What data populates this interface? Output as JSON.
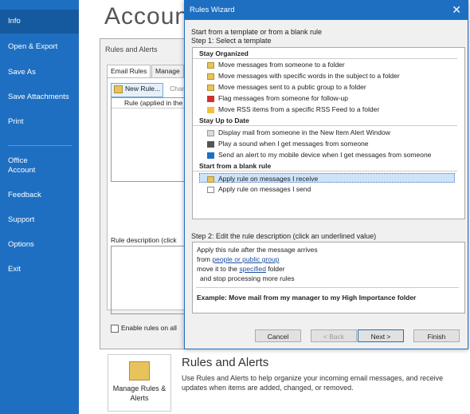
{
  "nav": {
    "items": [
      "Info",
      "Open & Export",
      "Save As",
      "Save Attachments",
      "Print",
      "Office Account",
      "Feedback",
      "Support",
      "Options",
      "Exit"
    ]
  },
  "main": {
    "title": "Accoun",
    "rules_dialog": {
      "title": "Rules and Alerts",
      "tab_email_rules": "Email Rules",
      "tab_manage": "Manage",
      "new_rule_button": "New Rule...",
      "change_button": "Chan",
      "rule_column_header": "Rule (applied in the",
      "rule_description_label": "Rule description (click",
      "enable_rules_label": "Enable rules on all"
    },
    "manage_button_label": "Manage Rules & Alerts",
    "section_heading": "Rules and Alerts",
    "section_description": "Use Rules and Alerts to help organize your incoming email messages, and receive updates when items are added, changed, or removed."
  },
  "wizard": {
    "title": "Rules Wizard",
    "start_text": "Start from a template or from a blank rule",
    "step1_label": "Step 1: Select a template",
    "groups": [
      {
        "name": "Stay Organized",
        "items": [
          {
            "label": "Move messages from someone to a folder",
            "icon": "folder-icon"
          },
          {
            "label": "Move messages with specific words in the subject to a folder",
            "icon": "folder-icon"
          },
          {
            "label": "Move messages sent to a public group to a folder",
            "icon": "folder-icon"
          },
          {
            "label": "Flag messages from someone for follow-up",
            "icon": "flag-icon"
          },
          {
            "label": "Move RSS items from a specific RSS Feed to a folder",
            "icon": "rss-icon"
          }
        ]
      },
      {
        "name": "Stay Up to Date",
        "items": [
          {
            "label": "Display mail from someone in the New Item Alert Window",
            "icon": "alert-window-icon"
          },
          {
            "label": "Play a sound when I get messages from someone",
            "icon": "speaker-icon"
          },
          {
            "label": "Send an alert to my mobile device when I get messages from someone",
            "icon": "phone-icon"
          }
        ]
      },
      {
        "name": "Start from a blank rule",
        "items": [
          {
            "label": "Apply rule on messages I receive",
            "icon": "folder-icon"
          },
          {
            "label": "Apply rule on messages I send",
            "icon": "blank-rule-icon"
          }
        ]
      }
    ],
    "step2_label": "Step 2: Edit the rule description (click an underlined value)",
    "desc_line1": "Apply this rule after the message arrives",
    "desc_line2_prefix": "from ",
    "desc_line2_link": "people or public group",
    "desc_line3_prefix": "move it to the ",
    "desc_line3_link": "specified",
    "desc_line3_suffix": " folder",
    "desc_line4": "and stop processing more rules",
    "example": "Example: Move mail from my manager to my High Importance folder",
    "buttons": {
      "cancel": "Cancel",
      "back": "< Back",
      "next": "Next >",
      "finish": "Finish"
    },
    "close_glyph": "✕"
  }
}
